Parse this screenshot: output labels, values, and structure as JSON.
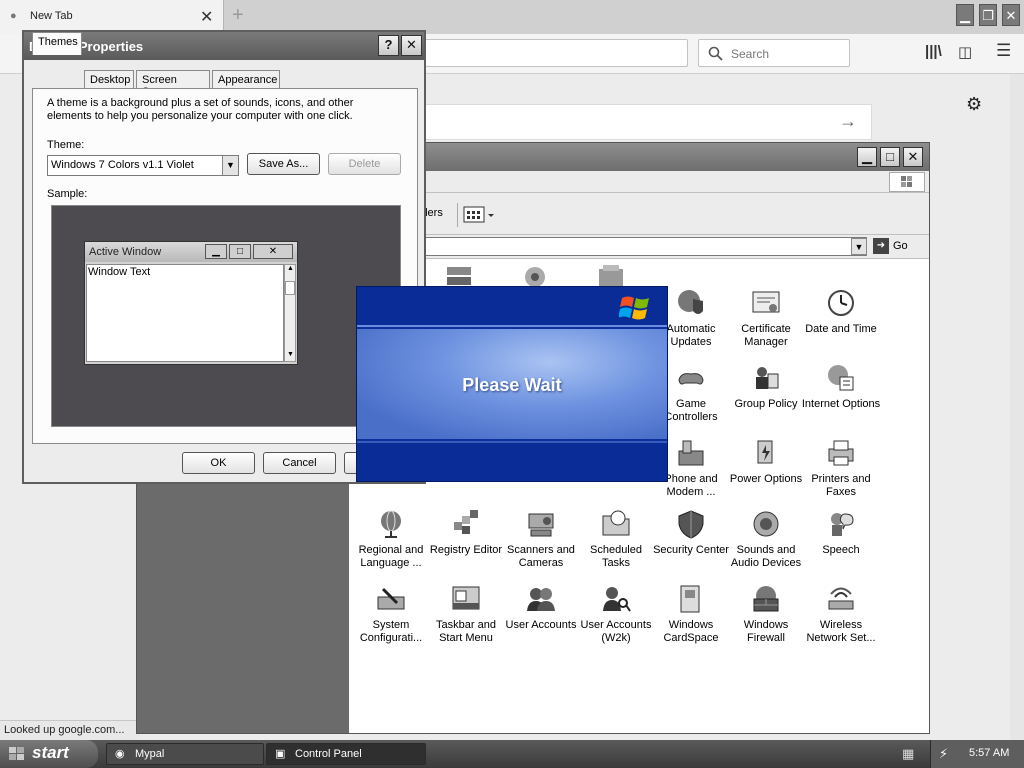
{
  "browser": {
    "tab_title": "New Tab",
    "tab_close": "✕",
    "new_tab": "+",
    "search_placeholder": "Search",
    "status_text": "Looked up google.com...",
    "win_minimize": "▁",
    "win_restore": "❐",
    "win_close": "✕"
  },
  "control_panel": {
    "go_label": "Go",
    "folders_partial": "lders",
    "items": [
      {
        "label": "Automatic Updates",
        "icon": "globe-shield-icon"
      },
      {
        "label": "Certificate Manager",
        "icon": "certificate-icon"
      },
      {
        "label": "Date and Time",
        "icon": "clock-icon"
      },
      {
        "label": "Game Controllers",
        "icon": "gamepad-icon"
      },
      {
        "label": "Group Policy",
        "icon": "users-policy-icon"
      },
      {
        "label": "Internet Options",
        "icon": "internet-options-icon"
      },
      {
        "label": "Phone and Modem ...",
        "icon": "phone-icon"
      },
      {
        "label": "Power Options",
        "icon": "power-icon"
      },
      {
        "label": "Printers and Faxes",
        "icon": "printer-icon"
      },
      {
        "label": "Regional and Language ...",
        "icon": "globe-icon"
      },
      {
        "label": "Registry Editor",
        "icon": "registry-icon"
      },
      {
        "label": "Scanners and Cameras",
        "icon": "scanner-icon"
      },
      {
        "label": "Scheduled Tasks",
        "icon": "folder-clock-icon"
      },
      {
        "label": "Security Center",
        "icon": "shield-icon"
      },
      {
        "label": "Sounds and Audio Devices",
        "icon": "speaker-icon"
      },
      {
        "label": "Speech",
        "icon": "speech-icon"
      },
      {
        "label": "System Configurati...",
        "icon": "system-config-icon"
      },
      {
        "label": "Taskbar and Start Menu",
        "icon": "taskbar-icon"
      },
      {
        "label": "User Accounts",
        "icon": "users-icon"
      },
      {
        "label": "User Accounts (W2k)",
        "icon": "users-key-icon"
      },
      {
        "label": "Windows CardSpace",
        "icon": "cardspace-icon"
      },
      {
        "label": "Windows Firewall",
        "icon": "firewall-icon"
      },
      {
        "label": "Wireless Network Set...",
        "icon": "wireless-icon"
      }
    ]
  },
  "display_properties": {
    "title": "Display Properties",
    "help_button": "?",
    "close_button": "✕",
    "tabs": [
      "Themes",
      "Desktop",
      "Screen Saver",
      "Appearance"
    ],
    "description": "A theme is a background plus a set of sounds, icons, and other elements to help you personalize your computer with one click.",
    "theme_label": "Theme:",
    "theme_value": "Windows 7 Colors v1.1 Violet",
    "save_as": "Save As...",
    "delete": "Delete",
    "sample_label": "Sample:",
    "active_window_title": "Active Window",
    "window_text": "Window Text",
    "ok": "OK",
    "cancel": "Cancel"
  },
  "please_wait": {
    "message": "Please Wait"
  },
  "taskbar": {
    "start": "start",
    "tasks": [
      "Mypal",
      "Control Panel"
    ],
    "clock": "5:57 AM"
  }
}
